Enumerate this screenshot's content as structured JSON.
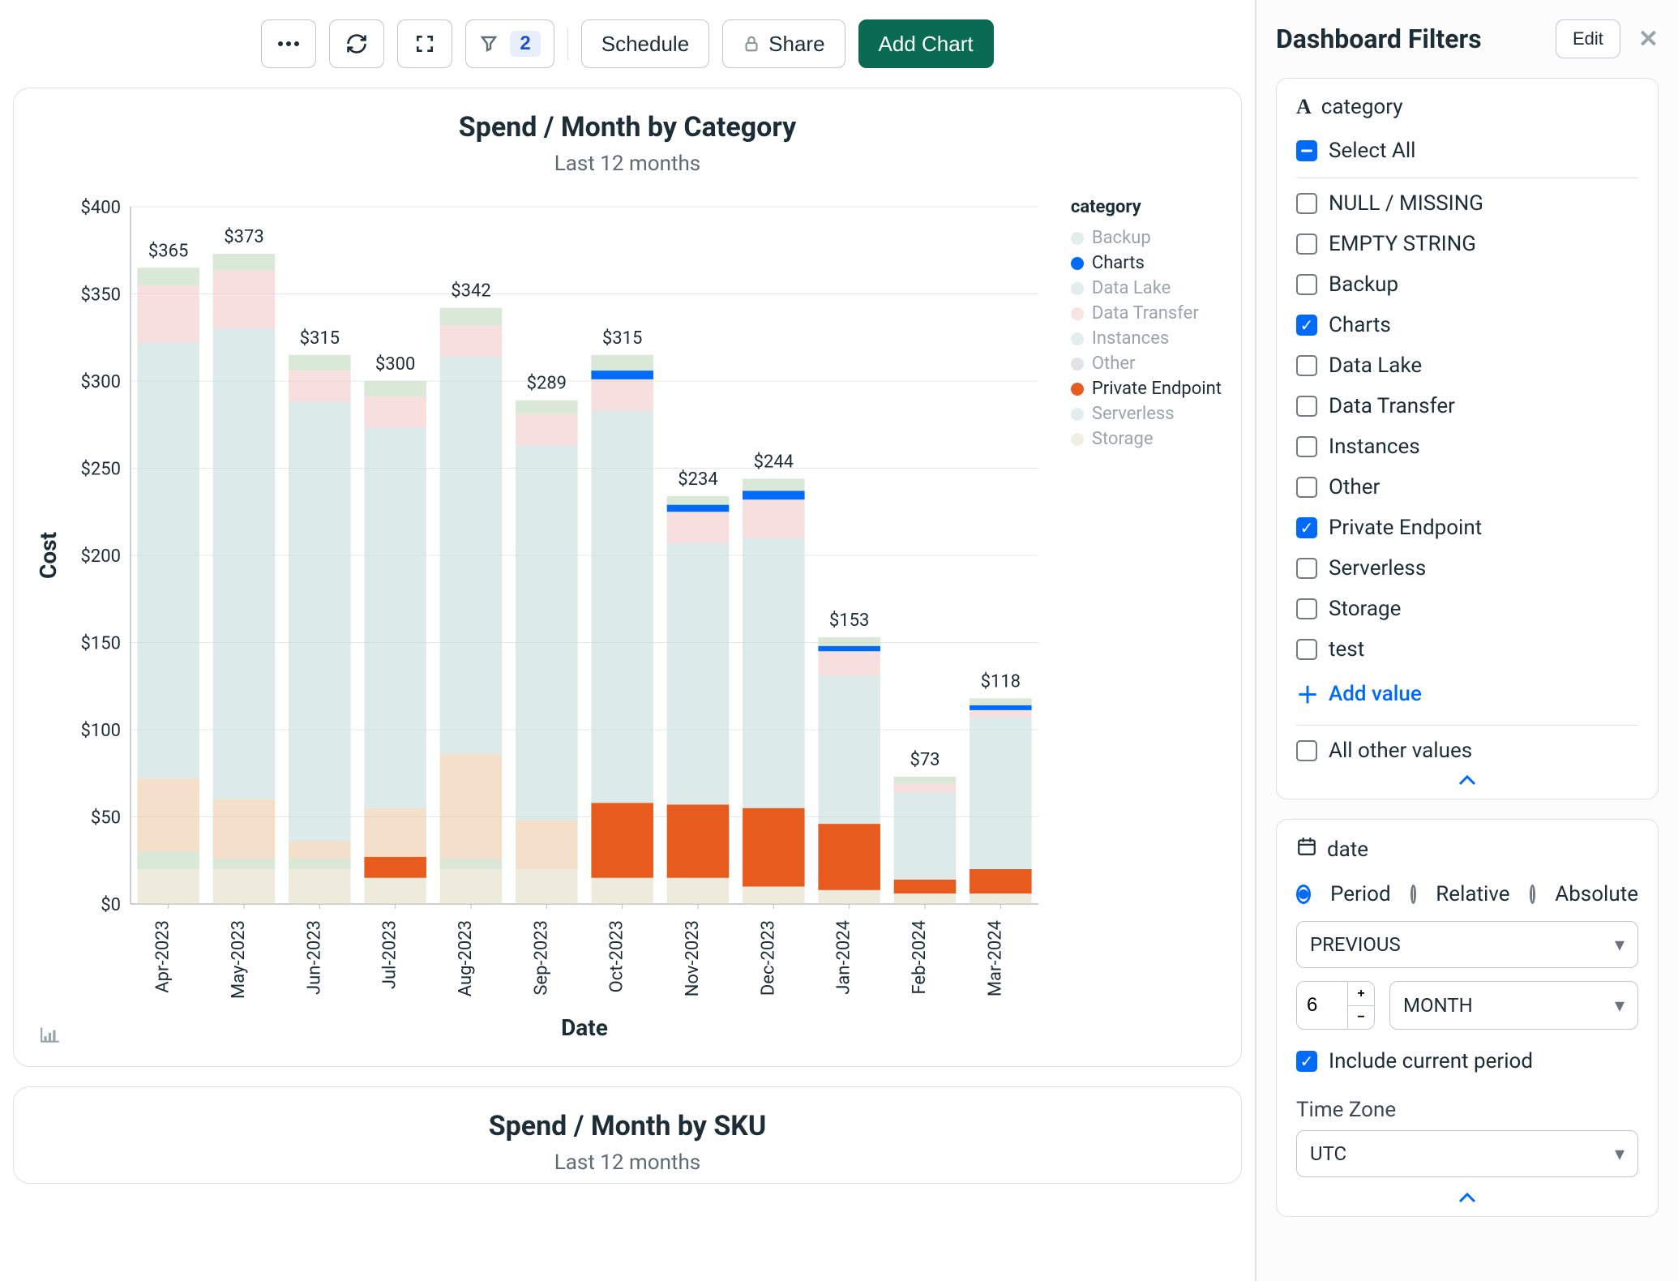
{
  "toolbar": {
    "filter_count": "2",
    "schedule": "Schedule",
    "share": "Share",
    "add_chart": "Add Chart"
  },
  "card": {
    "title": "Spend / Month by Category",
    "subtitle": "Last 12 months"
  },
  "card2": {
    "title": "Spend / Month by SKU",
    "subtitle": "Last 12 months"
  },
  "chart_data": {
    "type": "bar",
    "title": "Spend / Month by Category",
    "subtitle": "Last 12 months",
    "xlabel": "Date",
    "ylabel": "Cost",
    "ylim": [
      0,
      400
    ],
    "yticks": [
      0,
      50,
      100,
      150,
      200,
      250,
      300,
      350,
      400
    ],
    "ytick_labels": [
      "$0",
      "$50",
      "$100",
      "$150",
      "$200",
      "$250",
      "$300",
      "$350",
      "$400"
    ],
    "categories": [
      "Apr-2023",
      "May-2023",
      "Jun-2023",
      "Jul-2023",
      "Aug-2023",
      "Sep-2023",
      "Oct-2023",
      "Nov-2023",
      "Dec-2023",
      "Jan-2024",
      "Feb-2024",
      "Mar-2024"
    ],
    "totals": [
      365,
      373,
      315,
      300,
      342,
      289,
      315,
      234,
      244,
      153,
      73,
      118
    ],
    "legend_title": "category",
    "legend": [
      {
        "name": "Backup",
        "color": "#c4dddc",
        "muted": true
      },
      {
        "name": "Charts",
        "color": "#016bf8",
        "muted": false
      },
      {
        "name": "Data Lake",
        "color": "#c4dddc",
        "muted": true
      },
      {
        "name": "Data Transfer",
        "color": "#f3c9c9",
        "muted": true
      },
      {
        "name": "Instances",
        "color": "#c4dddc",
        "muted": true
      },
      {
        "name": "Other",
        "color": "#bfc8ce",
        "muted": true
      },
      {
        "name": "Private Endpoint",
        "color": "#e75b1e",
        "muted": false
      },
      {
        "name": "Serverless",
        "color": "#c4dddc",
        "muted": true
      },
      {
        "name": "Storage",
        "color": "#e3ddc6",
        "muted": true
      }
    ],
    "series": [
      {
        "name": "Storage",
        "color": "#e3ddc6",
        "muted": true,
        "values": [
          20,
          20,
          20,
          15,
          20,
          20,
          15,
          15,
          10,
          8,
          6,
          6
        ]
      },
      {
        "name": "Private Endpoint",
        "color": "#e75b1e",
        "muted": false,
        "values": [
          0,
          0,
          0,
          12,
          0,
          0,
          43,
          42,
          45,
          38,
          8,
          14
        ]
      },
      {
        "name": "Serverless",
        "color": "#c2d9bc",
        "muted": true,
        "values": [
          10,
          6,
          6,
          0,
          6,
          0,
          0,
          0,
          0,
          0,
          0,
          0
        ]
      },
      {
        "name": "Other",
        "color": "#edcaa8",
        "muted": true,
        "values": [
          42,
          34,
          10,
          28,
          60,
          28,
          0,
          0,
          0,
          0,
          0,
          0
        ]
      },
      {
        "name": "Instances",
        "color": "#c4dddc",
        "muted": true,
        "values": [
          250,
          270,
          252,
          218,
          228,
          215,
          225,
          150,
          155,
          85,
          50,
          87
        ]
      },
      {
        "name": "Data Transfer",
        "color": "#f3c9c9",
        "muted": true,
        "values": [
          33,
          33,
          18,
          18,
          18,
          18,
          18,
          18,
          22,
          14,
          5,
          5
        ]
      },
      {
        "name": "Data Lake",
        "color": "#c4dddc",
        "muted": true,
        "values": [
          0,
          0,
          0,
          0,
          0,
          0,
          0,
          0,
          0,
          0,
          0,
          0
        ]
      },
      {
        "name": "Charts",
        "color": "#016bf8",
        "muted": false,
        "values": [
          0,
          0,
          0,
          0,
          0,
          0,
          5,
          4,
          5,
          3,
          0,
          2
        ]
      },
      {
        "name": "Backup",
        "color": "#c2d9bc",
        "muted": true,
        "values": [
          10,
          10,
          9,
          9,
          10,
          8,
          9,
          5,
          7,
          5,
          4,
          4
        ]
      }
    ]
  },
  "sidebar": {
    "title": "Dashboard Filters",
    "edit": "Edit"
  },
  "filter_category": {
    "label": "category",
    "select_all": "Select All",
    "items": [
      {
        "label": "NULL / MISSING",
        "checked": false
      },
      {
        "label": "EMPTY STRING",
        "checked": false
      },
      {
        "label": "Backup",
        "checked": false
      },
      {
        "label": "Charts",
        "checked": true
      },
      {
        "label": "Data Lake",
        "checked": false
      },
      {
        "label": "Data Transfer",
        "checked": false
      },
      {
        "label": "Instances",
        "checked": false
      },
      {
        "label": "Other",
        "checked": false
      },
      {
        "label": "Private Endpoint",
        "checked": true
      },
      {
        "label": "Serverless",
        "checked": false
      },
      {
        "label": "Storage",
        "checked": false
      },
      {
        "label": "test",
        "checked": false
      }
    ],
    "add_value": "Add value",
    "all_other": "All other values"
  },
  "filter_date": {
    "label": "date",
    "mode_period": "Period",
    "mode_relative": "Relative",
    "mode_absolute": "Absolute",
    "previous": "PREVIOUS",
    "count": "6",
    "unit": "MONTH",
    "include_current": "Include current period",
    "tz_label": "Time Zone",
    "tz": "UTC"
  }
}
